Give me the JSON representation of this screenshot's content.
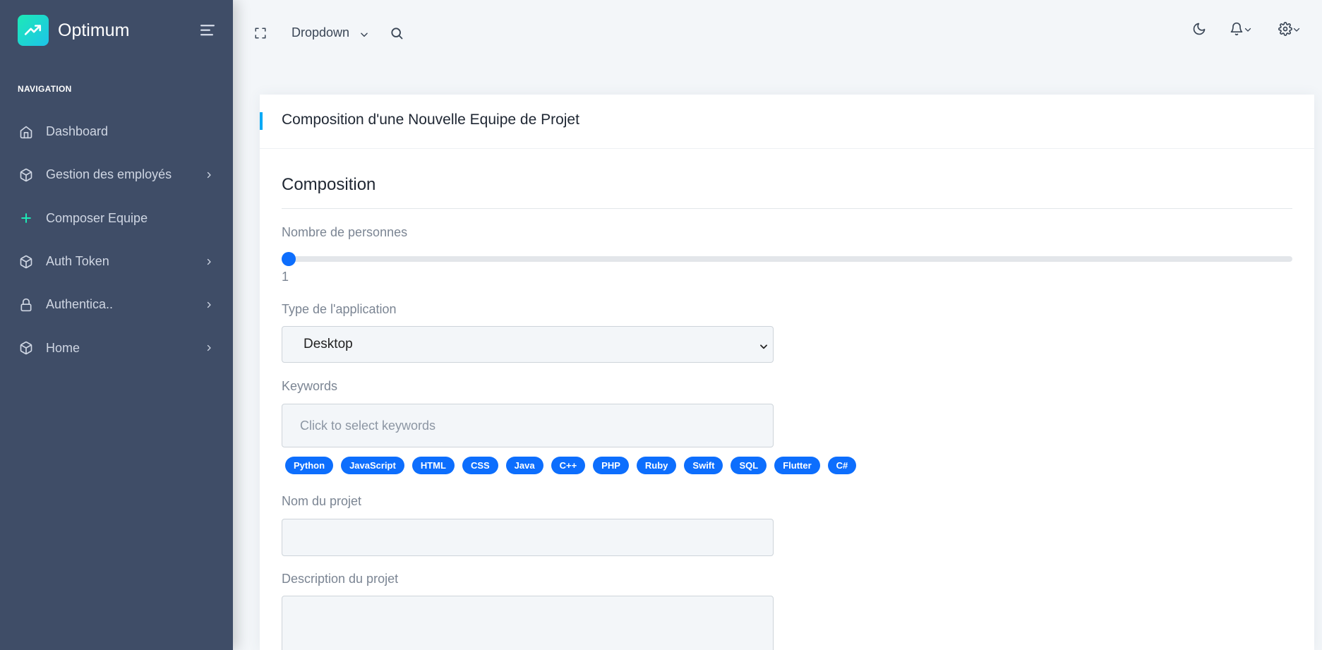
{
  "brand": {
    "name": "Optimum"
  },
  "sidebar": {
    "caption": "NAVIGATION",
    "items": [
      {
        "label": "Dashboard",
        "icon": "home-icon",
        "has_submenu": false
      },
      {
        "label": "Gestion des employés",
        "icon": "box-icon",
        "has_submenu": true
      },
      {
        "label": "Composer Equipe",
        "icon": "plus-icon",
        "has_submenu": false
      },
      {
        "label": "Auth Token",
        "icon": "box-icon",
        "has_submenu": true
      },
      {
        "label": "Authentica..",
        "icon": "lock-icon",
        "has_submenu": true
      },
      {
        "label": "Home",
        "icon": "box-icon",
        "has_submenu": true
      }
    ]
  },
  "header": {
    "dropdown_label": "Dropdown",
    "icons": [
      "fullscreen-icon",
      "search-icon",
      "moon-icon",
      "bell-icon",
      "gear-icon"
    ]
  },
  "card": {
    "title": "Composition d'une Nouvelle Equipe de Projet",
    "section_title": "Composition",
    "slider": {
      "label": "Nombre de personnes",
      "value": "1"
    },
    "app_type": {
      "label": "Type de l'application",
      "selected": "Desktop"
    },
    "keywords": {
      "label": "Keywords",
      "placeholder": "Click to select keywords",
      "options": [
        "Python",
        "JavaScript",
        "HTML",
        "CSS",
        "Java",
        "C++",
        "PHP",
        "Ruby",
        "Swift",
        "SQL",
        "Flutter",
        "C#"
      ]
    },
    "project_name": {
      "label": "Nom du projet",
      "value": ""
    },
    "project_description": {
      "label": "Description du projet",
      "value": ""
    }
  },
  "colors": {
    "sidebar_bg": "#3f4d67",
    "accent": "#04a9f5",
    "brand_gradient_start": "#1de9b6",
    "brand_gradient_end": "#1dc4e9",
    "chip": "#0d6efd"
  }
}
